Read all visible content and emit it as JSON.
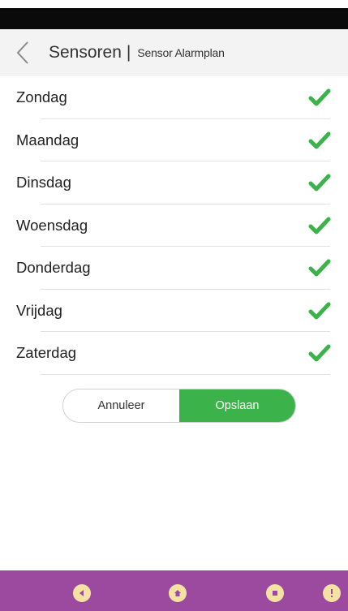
{
  "header": {
    "title": "Sensoren",
    "separator": "|",
    "subtitle": "Sensor Alarmplan"
  },
  "days": [
    {
      "label": "Zondag",
      "checked": true
    },
    {
      "label": "Maandag",
      "checked": true
    },
    {
      "label": "Dinsdag",
      "checked": true
    },
    {
      "label": "Woensdag",
      "checked": true
    },
    {
      "label": "Donderdag",
      "checked": true
    },
    {
      "label": "Vrijdag",
      "checked": true
    },
    {
      "label": "Zaterdag",
      "checked": true
    }
  ],
  "actions": {
    "cancel_label": "Annuleer",
    "save_label": "Opslaan"
  },
  "colors": {
    "accent": "#3cb34a",
    "nav_bar": "#9b4aa0",
    "header_bg": "#f3f3f3"
  },
  "nav": {
    "icons": [
      "back-icon",
      "home-icon",
      "recents-icon",
      "info-icon"
    ]
  }
}
